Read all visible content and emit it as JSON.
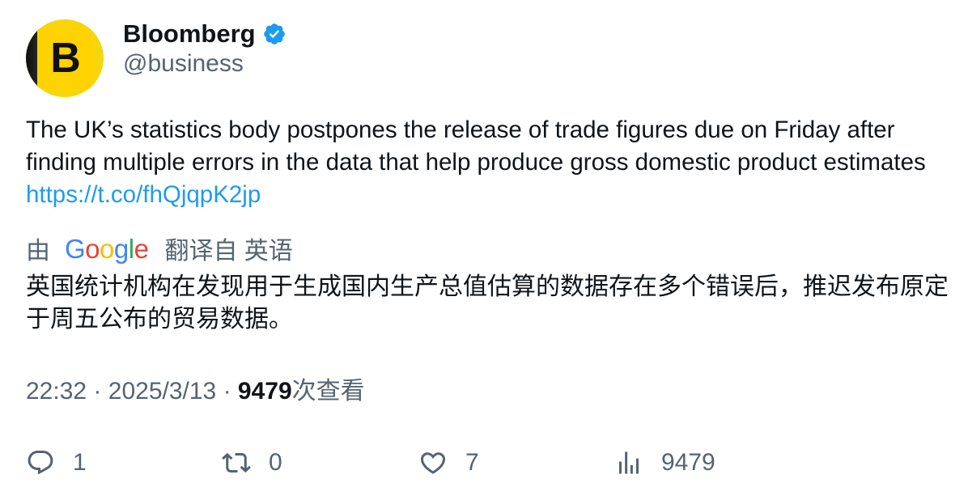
{
  "author": {
    "avatar_letter": "B",
    "display_name": "Bloomberg",
    "handle": "@business",
    "verified": true,
    "brand_color": "#ffd200"
  },
  "tweet": {
    "text": "The UK’s statistics body postpones the release of trade figures due on Friday after finding multiple errors in the data that help produce gross domestic product estimates ",
    "link": "https://t.co/fhQjqpK2jp",
    "link_color": "#1d9bf0"
  },
  "translation": {
    "prefix": "由",
    "provider_logo": "Google",
    "suffix": "翻译自 英语",
    "text": "英国统计机构在发现用于生成国内生产总值估算的数据存在多个错误后，推迟发布原定于周五公布的贸易数据。"
  },
  "meta": {
    "time": "22:32",
    "separator": "·",
    "date": "2025/3/13",
    "views_count": "9479",
    "views_label": "次查看"
  },
  "actions": {
    "replies": "1",
    "retweets": "0",
    "likes": "7",
    "views": "9479"
  }
}
